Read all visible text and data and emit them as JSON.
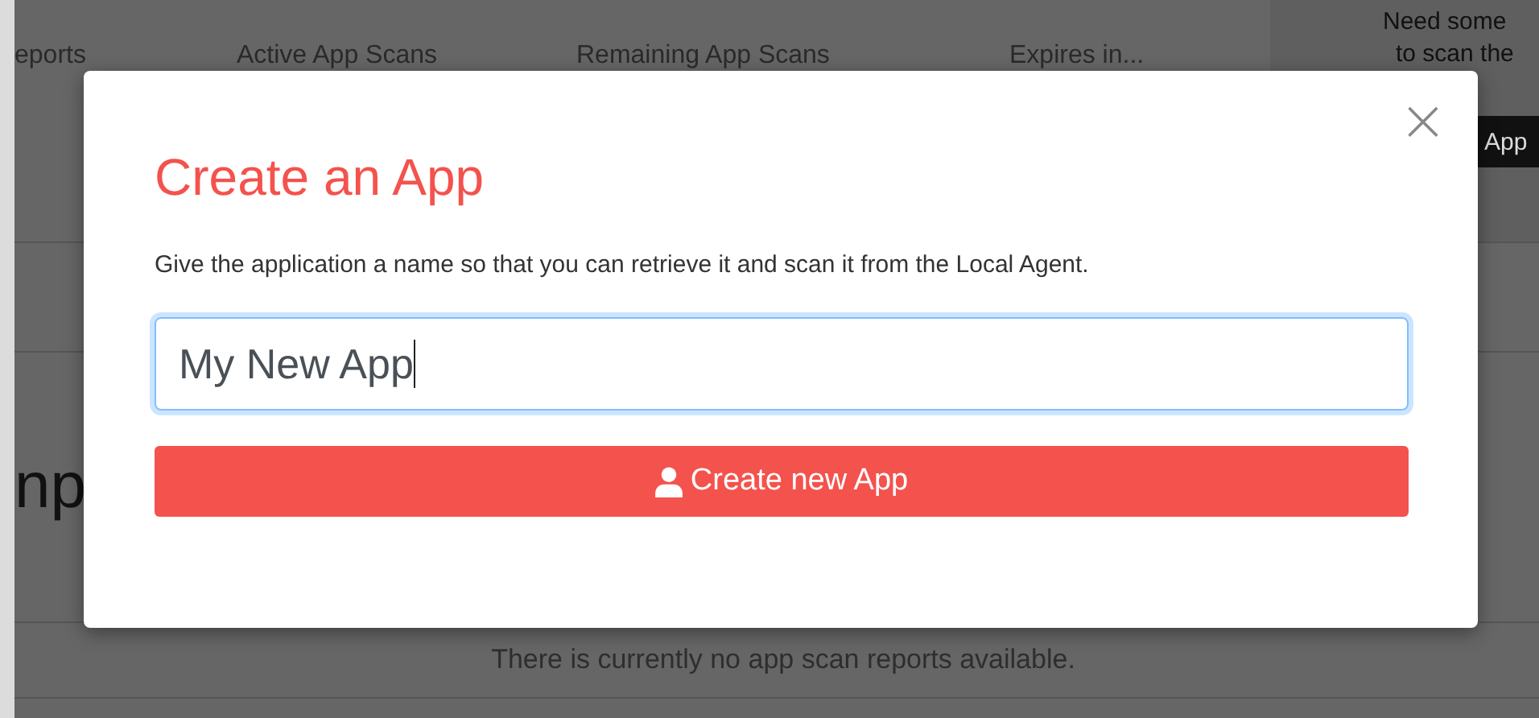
{
  "background": {
    "columns": [
      "eports",
      "Active App Scans",
      "Remaining App Scans",
      "Expires in..."
    ],
    "side_text": [
      "Need some",
      "to scan the"
    ],
    "side_button": "App",
    "heading": "np",
    "empty_message": "There is currently no app scan reports available."
  },
  "modal": {
    "title": "Create an App",
    "close": "×",
    "description": "Give the application a name so that you can retrieve it and scan it from the Local Agent.",
    "input": {
      "value": "My New App",
      "focused": true
    },
    "button": "Create new App"
  }
}
